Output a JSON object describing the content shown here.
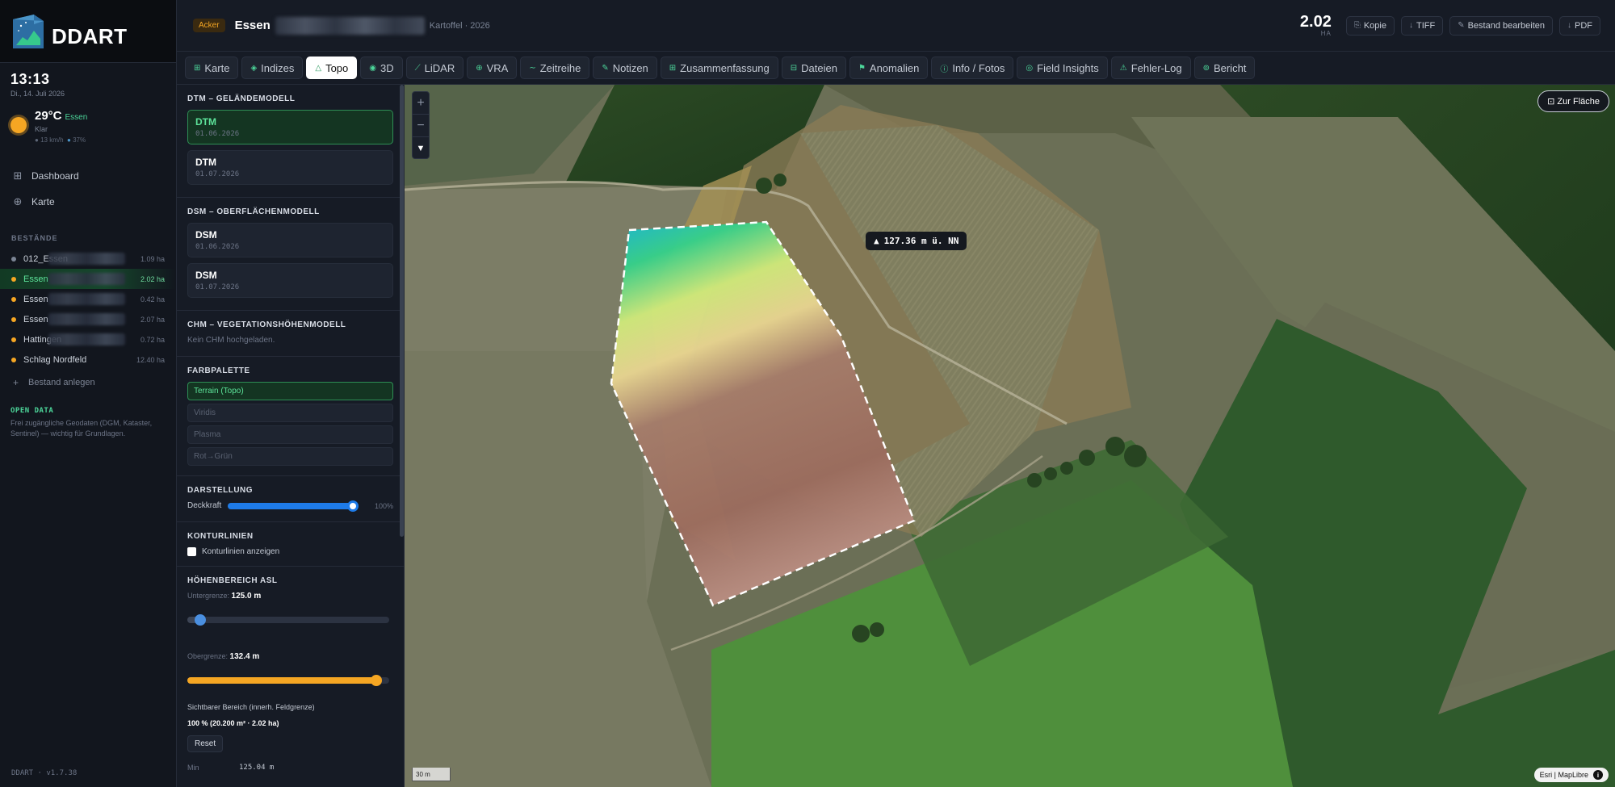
{
  "brand": {
    "name": "DDART"
  },
  "clock": {
    "time": "13:13",
    "date": "Di., 14. Juli 2026"
  },
  "weather": {
    "temp": "29°C",
    "location": "Essen",
    "condition": "Klar",
    "wind": "13 km/h",
    "humidity": "37%"
  },
  "nav": [
    {
      "label": "Dashboard",
      "icon": "grid-icon"
    },
    {
      "label": "Karte",
      "icon": "globe-icon"
    }
  ],
  "stands": {
    "heading": "BESTÄNDE",
    "items": [
      {
        "label": "012_Essen",
        "ha": "1.09 ha",
        "color": "#7b8494"
      },
      {
        "label": "Essen",
        "ha": "2.02 ha",
        "color": "#f5a623"
      },
      {
        "label": "Essen",
        "ha": "0.42 ha",
        "color": "#f5a623"
      },
      {
        "label": "Essen",
        "ha": "2.07 ha",
        "color": "#f5a623"
      },
      {
        "label": "Hattingen",
        "ha": "0.72 ha",
        "color": "#f5a623"
      },
      {
        "label": "Schlag Nordfeld",
        "ha": "12.40 ha",
        "color": "#f5a623"
      }
    ],
    "add_label": "Bestand anlegen"
  },
  "open_data": {
    "title": "OPEN DATA",
    "text": "Frei zugängliche Geodaten (DGM, Kataster, Sentinel) — wichtig für Grundlagen."
  },
  "version": "DDART · v1.7.38",
  "header": {
    "badge": "Acker",
    "field_name": "Essen",
    "subtitle": "Kartoffel · 2026",
    "area_value": "2.02",
    "area_unit": "HA",
    "buttons": [
      {
        "label": "Kopie",
        "icon": "copy-icon"
      },
      {
        "label": "TIFF",
        "icon": "download-icon"
      },
      {
        "label": "Bestand bearbeiten",
        "icon": "edit-icon"
      },
      {
        "label": "PDF",
        "icon": "download-icon"
      }
    ]
  },
  "tabs": [
    {
      "label": "Karte"
    },
    {
      "label": "Indizes"
    },
    {
      "label": "Topo"
    },
    {
      "label": "3D"
    },
    {
      "label": "LiDAR"
    },
    {
      "label": "VRA"
    },
    {
      "label": "Zeitreihe"
    },
    {
      "label": "Notizen"
    },
    {
      "label": "Zusammenfassung"
    },
    {
      "label": "Dateien"
    },
    {
      "label": "Anomalien"
    },
    {
      "label": "Info / Fotos"
    },
    {
      "label": "Field Insights"
    },
    {
      "label": "Fehler-Log"
    },
    {
      "label": "Bericht"
    }
  ],
  "active_tab": "Topo",
  "panel": {
    "dtm": {
      "title": "DTM – GELÄNDEMODELL",
      "items": [
        {
          "name": "DTM",
          "date": "01.06.2026"
        },
        {
          "name": "DTM",
          "date": "01.07.2026"
        }
      ]
    },
    "dsm": {
      "title": "DSM – OBERFLÄCHENMODELL",
      "items": [
        {
          "name": "DSM",
          "date": "01.06.2026"
        },
        {
          "name": "DSM",
          "date": "01.07.2026"
        }
      ]
    },
    "chm": {
      "title": "CHM – VEGETATIONSHÖHENMODELL",
      "empty": "Kein CHM hochgeladen."
    },
    "palette": {
      "title": "FARBPALETTE",
      "options": [
        "Terrain (Topo)",
        "Viridis",
        "Plasma",
        "Rot→Grün"
      ],
      "selected": "Terrain (Topo)"
    },
    "display": {
      "title": "DARSTELLUNG",
      "opacity_label": "Deckkraft",
      "opacity_value": "100%",
      "opacity": 1.0
    },
    "contour": {
      "title": "KONTURLINIEN",
      "checkbox_label": "Konturlinien anzeigen"
    },
    "range": {
      "title": "HÖHENBEREICH ASL",
      "lower_label": "Untergrenze:",
      "lower_value": "125.0 m",
      "lower_fraction": 0.04,
      "upper_label": "Obergrenze:",
      "upper_value": "132.4 m",
      "upper_fraction": 0.96,
      "visible_label": "Sichtbarer Bereich (innerh. Feldgrenze)",
      "visible_value": "100 % (20.200 m² · 2.02 ha)",
      "reset_label": "Reset",
      "min_label": "Min",
      "min_value": "125.04 m"
    }
  },
  "map": {
    "tooltip": "127.36 m ü. NN",
    "zoom_to_field": "Zur Fläche",
    "scale": "30 m",
    "attribution": "Esri | MapLibre"
  }
}
